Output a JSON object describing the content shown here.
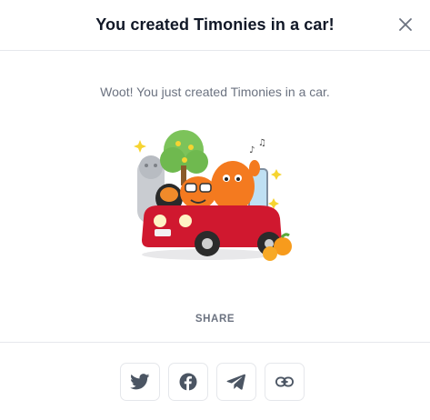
{
  "modal": {
    "title": "You created Timonies in a car!",
    "message": "Woot! You just created Timonies in a car.",
    "share_label": "SHARE",
    "share_buttons": [
      {
        "name": "twitter",
        "icon": "twitter-icon"
      },
      {
        "name": "facebook",
        "icon": "facebook-icon"
      },
      {
        "name": "telegram",
        "icon": "telegram-icon"
      },
      {
        "name": "copy-link",
        "icon": "link-icon"
      }
    ],
    "close_icon": "close-icon"
  },
  "colors": {
    "icon": "#4b5563",
    "car": "#d0182f",
    "monster_orange": "#f47a1f"
  }
}
